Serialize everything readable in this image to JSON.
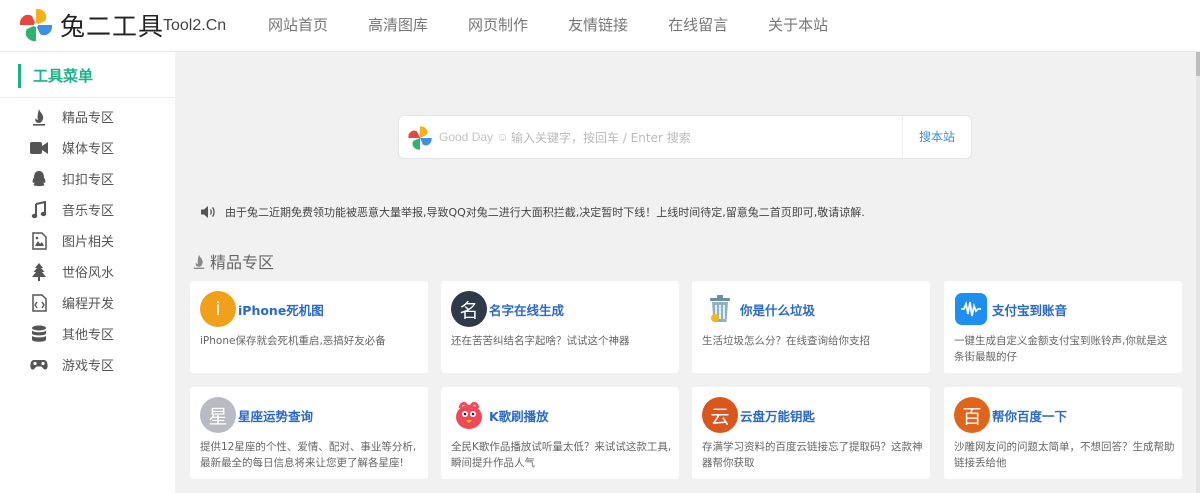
{
  "header": {
    "brand": "兔二工具",
    "brand_sub": "Tool2.Cn",
    "nav": [
      "网站首页",
      "高清图库",
      "网页制作",
      "友情链接",
      "在线留言",
      "关于本站"
    ]
  },
  "sidebar": {
    "title": "工具菜单",
    "items": [
      {
        "label": "精品专区",
        "icon": "fire-icon"
      },
      {
        "label": "媒体专区",
        "icon": "video-camera-icon"
      },
      {
        "label": "扣扣专区",
        "icon": "qq-penguin-icon"
      },
      {
        "label": "音乐专区",
        "icon": "music-note-icon"
      },
      {
        "label": "图片相关",
        "icon": "image-file-icon"
      },
      {
        "label": "世俗风水",
        "icon": "tree-icon"
      },
      {
        "label": "编程开发",
        "icon": "code-file-icon"
      },
      {
        "label": "其他专区",
        "icon": "database-icon"
      },
      {
        "label": "游戏专区",
        "icon": "gamepad-icon"
      }
    ]
  },
  "search": {
    "hint": "Good Day",
    "placeholder": "输入关键字，按回车 / Enter 搜索",
    "value": "",
    "button": "搜本站"
  },
  "notice": {
    "text": "由于兔二近期免费领功能被恶意大量举报,导致QQ对兔二进行大面积拦截,决定暂时下线！上线时间待定,留意兔二首页即可,敬请谅解."
  },
  "section": {
    "title": "精品专区"
  },
  "cards": [
    {
      "title": "iPhone死机图",
      "desc": "iPhone保存就会死机重启,恶搞好友必备",
      "icon_text": "i",
      "icon_color": "#f0a01a"
    },
    {
      "title": "名字在线生成",
      "desc": "还在苦苦纠结名字起啥？试试这个神器",
      "icon_text": "名",
      "icon_color": "#2e3a4a"
    },
    {
      "title": "你是什么垃圾",
      "desc": "生活垃圾怎么分？在线查询给你支招",
      "icon_text": "",
      "icon_color": "#6b8fa0"
    },
    {
      "title": "支付宝到账音",
      "desc": "一键生成自定义金额支付宝到账铃声,你就是这条街最靓的仔",
      "icon_text": "",
      "icon_color": "#1e8ff0"
    },
    {
      "title": "星座运势查询",
      "desc": "提供12星座的个性、爱情、配对、事业等分析,最新最全的每日信息将来让您更了解各星座!",
      "icon_text": "星",
      "icon_color": "#b8bcc2"
    },
    {
      "title": "K歌刷播放",
      "desc": "全民K歌作品播放试听量太低？来试试这款工具,瞬间提升作品人气",
      "icon_text": "",
      "icon_color": "#f04a5a"
    },
    {
      "title": "云盘万能钥匙",
      "desc": "存满学习资料的百度云链接忘了提取码？这款神器帮你获取",
      "icon_text": "云",
      "icon_color": "#d9561d"
    },
    {
      "title": "帮你百度一下",
      "desc": "沙雕网友问的问题太简单，不想回答？生成帮助链接丢给他",
      "icon_text": "百",
      "icon_color": "#e0651c"
    }
  ]
}
